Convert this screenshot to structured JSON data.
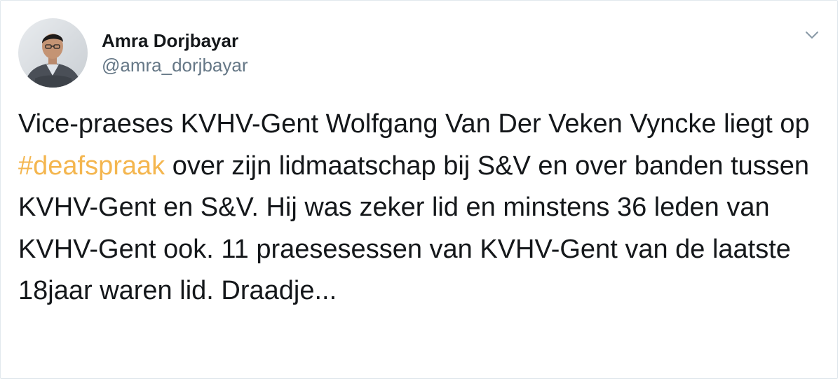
{
  "tweet": {
    "author": {
      "display_name": "Amra Dorjbayar",
      "handle": "@amra_dorjbayar"
    },
    "menu_icon": "chevron-down-icon",
    "text_segments": {
      "before_hashtag": "Vice-praeses KVHV-Gent Wolfgang Van Der Veken Vyncke liegt op ",
      "hashtag": "#deafspraak",
      "after_hashtag": " over zijn lidmaatschap bij S&V en over banden tussen KVHV-Gent en S&V. Hij was zeker lid en minstens 36 leden van KVHV-Gent ook. 11 praesesessen van KVHV-Gent van de laatste 18jaar waren lid. Draadje..."
    },
    "colors": {
      "hashtag": "#f4b64f",
      "text": "#14171a",
      "secondary": "#657786",
      "border": "#e1e8ed"
    }
  }
}
